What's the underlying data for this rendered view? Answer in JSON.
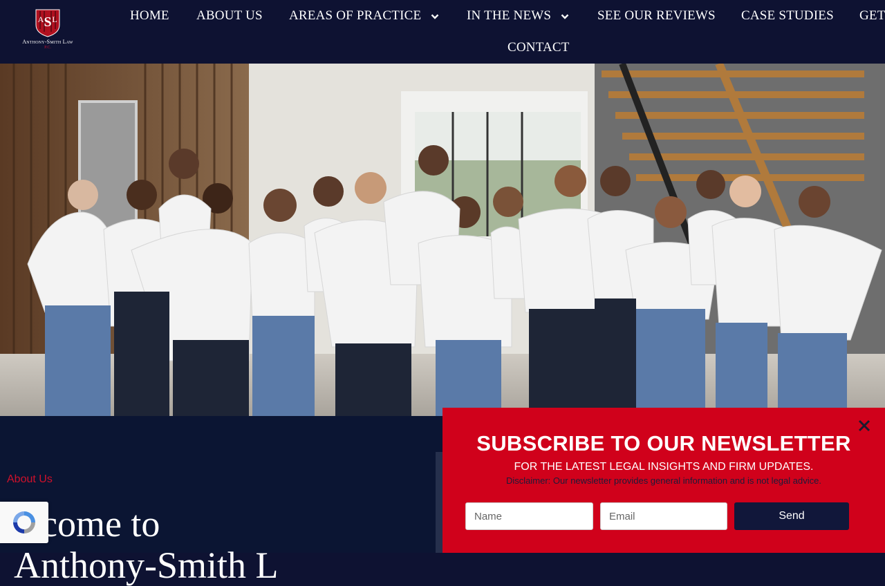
{
  "brand": {
    "name": "Anthony-Smith Law",
    "suffix": "P.C.",
    "monogram": "ASL"
  },
  "nav": {
    "home": "HOME",
    "about": "ABOUT US",
    "practice": "AREAS OF PRACTICE",
    "news": "IN THE NEWS",
    "reviews": "SEE OUR REVIEWS",
    "cases": "CASE STUDIES",
    "get": "GET",
    "contact": "CONTACT"
  },
  "about": {
    "label": "About Us",
    "heading_line1": "elcome to",
    "heading_line2": "Anthony-Smith L"
  },
  "newsletter": {
    "title": "SUBSCRIBE TO OUR NEWSLETTER",
    "subtitle": "FOR THE LATEST LEGAL INSIGHTS AND FIRM UPDATES.",
    "disclaimer": "Disclaimer: Our newsletter provides general information and is not legal advice.",
    "name_placeholder": "Name",
    "email_placeholder": "Email",
    "send_label": "Send"
  },
  "colors": {
    "navy": "#0e1232",
    "accent_red": "#d0011b",
    "button_navy": "#11173a"
  },
  "icons": {
    "close": "close-icon",
    "chevron": "chevron-down-icon",
    "recaptcha": "recaptcha-icon"
  }
}
